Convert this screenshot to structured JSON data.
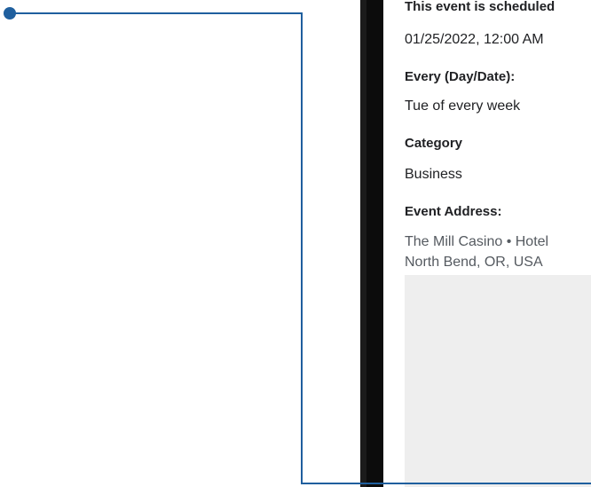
{
  "event": {
    "schedule_label": "This event is scheduled",
    "schedule_value": "01/25/2022, 12:00 AM",
    "every_label": "Every (Day/Date):",
    "every_value": "Tue of every week",
    "category_label": "Category",
    "category_value": "Business",
    "address_label": "Event Address:",
    "address_line1": "The Mill Casino • Hotel",
    "address_line2": "North Bend, OR, USA"
  },
  "colors": {
    "callout": "#1f5f9e",
    "device_frame": "#1b1b1b",
    "map_placeholder": "#eeeeee"
  }
}
